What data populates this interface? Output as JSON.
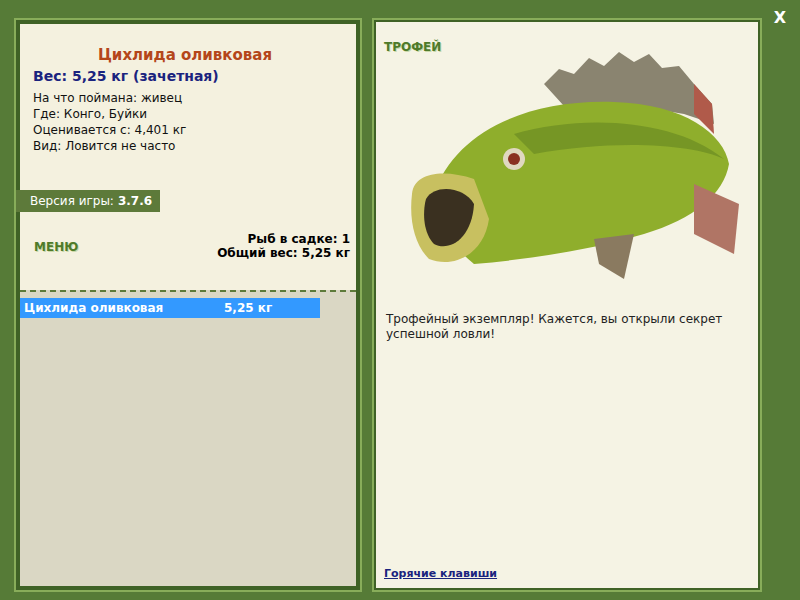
{
  "close": "X",
  "fish_card": {
    "title": "Цихлида оливковая",
    "weight": "Вес: 5,25 кг (зачетная)",
    "details": [
      "На что поймана: живец",
      "Где: Конго, Буйки",
      "Оценивается с: 4,401 кг",
      "Вид: Ловится не часто"
    ]
  },
  "version": {
    "label": "Версия игры:",
    "value": "3.7.6"
  },
  "menu": "МЕНЮ",
  "keepnet": {
    "count": "Рыб в садке: 1",
    "total": "Общий вес: 5,25 кг"
  },
  "catch_list": [
    {
      "name": "Цихлида оливковая",
      "weight": "5,25 кг",
      "selected": true
    }
  ],
  "trophy": {
    "badge": "ТРОФЕЙ",
    "message": "Трофейный экземпляр! Кажется, вы открыли секрет успешной ловли!"
  },
  "hotkeys": "Горячие клавиши"
}
